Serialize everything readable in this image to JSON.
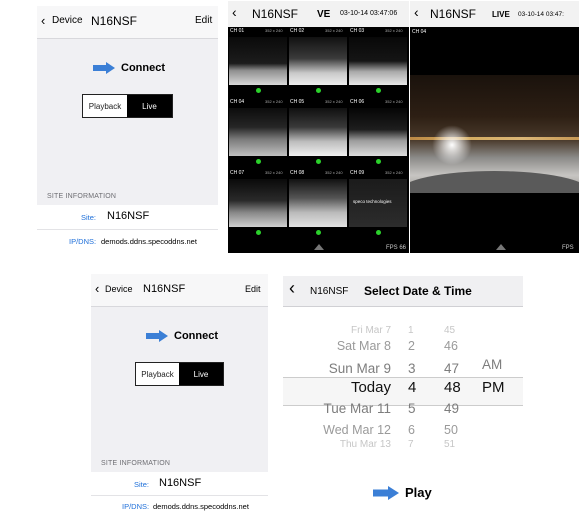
{
  "screen1": {
    "back_label": "Device",
    "title": "N16NSF",
    "edit_label": "Edit",
    "connect_label": "Connect",
    "segment": {
      "playback": "Playback",
      "live": "Live"
    },
    "section": "SITE INFORMATION",
    "site_label": "Site:",
    "site_value": "N16NSF",
    "ipdns_label": "IP/DNS:",
    "ipdns_value": "demods.ddns.specoddns.net"
  },
  "screen2": {
    "title": "N16NSF",
    "mode": "VE",
    "timestamp": "03-10-14 03:47:06",
    "channels": [
      "CH 01",
      "CH 02",
      "CH 03",
      "CH 04",
      "CH 05",
      "CH 06",
      "CH 07",
      "CH 08",
      "CH 09"
    ],
    "resolution": "352 x 240",
    "brand": "speco technologies",
    "fps": "FPS 66"
  },
  "screen3": {
    "title": "N16NSF",
    "mode": "LIVE",
    "timestamp": "03-10-14 03:47:",
    "channel": "CH 04",
    "fps": "FPS"
  },
  "screen4": {
    "back_label": "Device",
    "title": "N16NSF",
    "edit_label": "Edit",
    "connect_label": "Connect",
    "segment": {
      "playback": "Playback",
      "live": "Live"
    },
    "section": "SITE INFORMATION",
    "site_label": "Site:",
    "site_value": "N16NSF",
    "ipdns_label": "IP/DNS:",
    "ipdns_value": "demods.ddns.specoddns.net"
  },
  "screen5": {
    "title_left": "N16NSF",
    "title": "Select Date & Time",
    "days": [
      "Fri Mar 7",
      "Sat Mar 8",
      "Sun Mar 9",
      "Today",
      "Tue Mar 11",
      "Wed Mar 12",
      "Thu Mar 13"
    ],
    "hours": [
      "1",
      "2",
      "3",
      "4",
      "5",
      "6",
      "7"
    ],
    "minutes": [
      "45",
      "46",
      "47",
      "48",
      "49",
      "50",
      "51"
    ],
    "ampm": [
      "AM",
      "PM"
    ],
    "play_label": "Play"
  },
  "colors": {
    "link": "#1e6fd9",
    "arrow": "#3b7fd6",
    "live_dot": "#2bd12b"
  }
}
